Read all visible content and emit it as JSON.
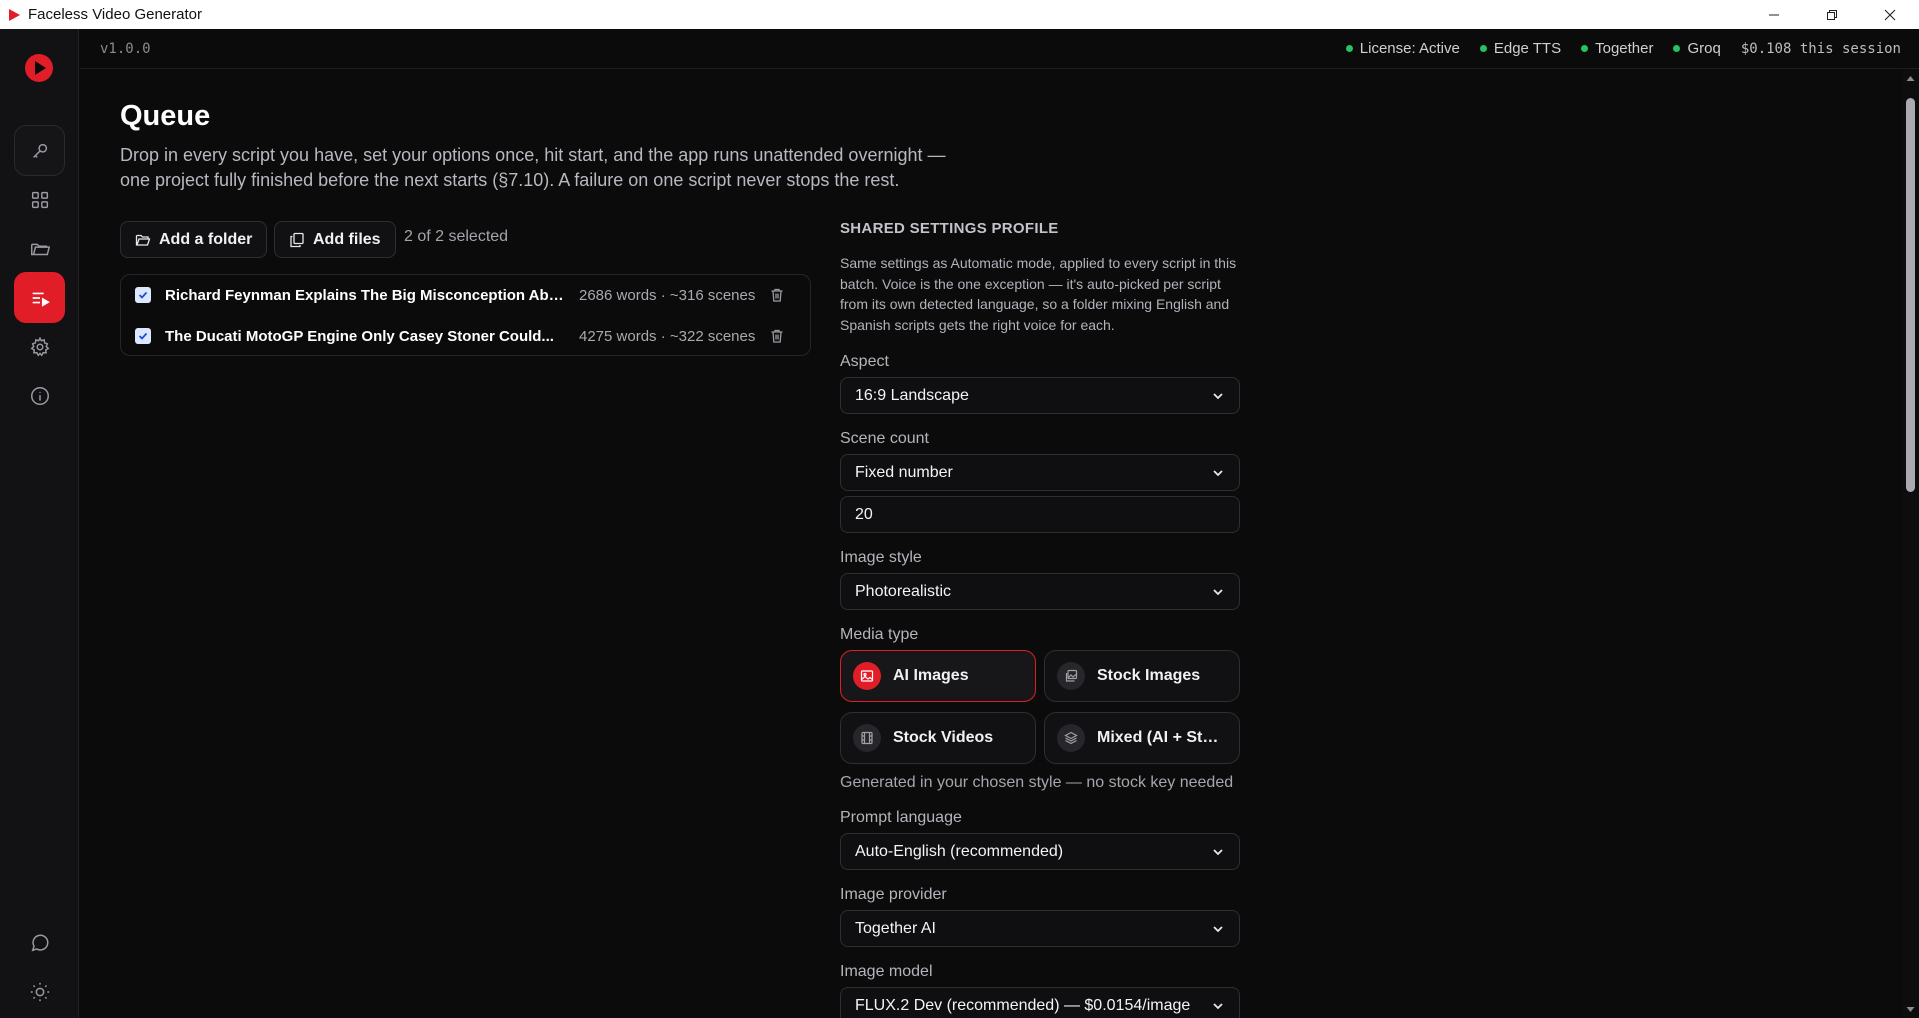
{
  "window": {
    "title": "Faceless Video Generator",
    "controls": [
      "minimize-icon",
      "restore-icon",
      "close-icon"
    ]
  },
  "topbar": {
    "version": "v1.0.0",
    "statuses": [
      {
        "label": "License: Active",
        "color": "#22c55e"
      },
      {
        "label": "Edge TTS",
        "color": "#22c55e"
      },
      {
        "label": "Together",
        "color": "#22c55e"
      },
      {
        "label": "Groq",
        "color": "#22c55e"
      }
    ],
    "cost": "$0.108 this session"
  },
  "sidebar": {
    "items": [
      {
        "name": "key-icon",
        "active": false
      },
      {
        "name": "grid-icon",
        "active": false
      },
      {
        "name": "folder-icon",
        "active": false
      },
      {
        "name": "queue-icon",
        "active": true
      },
      {
        "name": "gear-icon",
        "active": false
      },
      {
        "name": "info-icon",
        "active": false
      },
      {
        "name": "chat-icon",
        "active": false
      },
      {
        "name": "sun-icon",
        "active": false
      }
    ],
    "accent": "#e11d27"
  },
  "queue": {
    "title": "Queue",
    "description": "Drop in every script you have, set your options once, hit start, and the app runs unattended overnight — one project fully finished before the next starts (§7.10). A failure on one script never stops the rest.",
    "add_folder_label": "Add a folder",
    "add_files_label": "Add files",
    "selected_text": "2 of 2 selected",
    "items": [
      {
        "title": "Richard Feynman Explains The Big Misconception About...",
        "meta": "2686 words · ~316 scenes",
        "checked": true
      },
      {
        "title": "The Ducati MotoGP Engine Only Casey Stoner Could...",
        "meta": "4275 words · ~322 scenes",
        "checked": true
      }
    ]
  },
  "settings": {
    "section_title": "SHARED SETTINGS PROFILE",
    "section_desc": "Same settings as Automatic mode, applied to every script in this batch. Voice is the one exception — it's auto-picked per script from its own detected language, so a folder mixing English and Spanish scripts gets the right voice for each.",
    "aspect": {
      "label": "Aspect",
      "value": "16:9 Landscape"
    },
    "scene_count": {
      "label": "Scene count",
      "value": "Fixed number",
      "number": "20"
    },
    "image_style": {
      "label": "Image style",
      "value": "Photorealistic"
    },
    "media_type": {
      "label": "Media type",
      "options": [
        {
          "label": "AI Images",
          "icon": "image-icon",
          "active": true
        },
        {
          "label": "Stock Images",
          "icon": "gallery-icon",
          "active": false
        },
        {
          "label": "Stock Videos",
          "icon": "film-icon",
          "active": false
        },
        {
          "label": "Mixed (AI + Stock)",
          "icon": "layers-icon",
          "active": false
        }
      ],
      "help": "Generated in your chosen style — no stock key needed"
    },
    "prompt_language": {
      "label": "Prompt language",
      "value": "Auto-English (recommended)"
    },
    "image_provider": {
      "label": "Image provider",
      "value": "Together AI"
    },
    "image_model": {
      "label": "Image model",
      "value": "FLUX.2 Dev (recommended) — $0.0154/image"
    }
  }
}
